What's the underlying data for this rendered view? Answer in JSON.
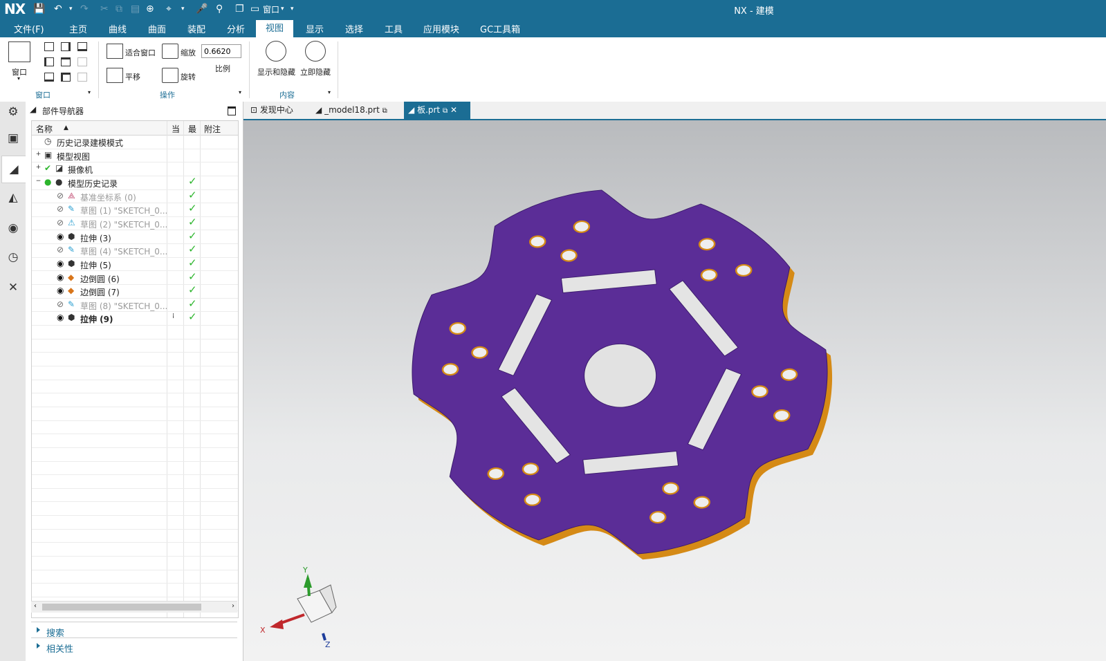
{
  "app": {
    "logo": "NX",
    "window_title": "NX - 建模",
    "window_menu": "窗口"
  },
  "menu": [
    "文件(F)",
    "主页",
    "曲线",
    "曲面",
    "装配",
    "分析",
    "视图",
    "显示",
    "选择",
    "工具",
    "应用模块",
    "GC工具箱"
  ],
  "active_menu": "视图",
  "ribbon": {
    "window_btn": "窗口",
    "fit": "适合窗口",
    "zoom": "缩放",
    "pan": "平移",
    "rotate": "旋转",
    "scale_value": "0.6620",
    "scale_label": "比例",
    "show_hide": "显示和隐藏",
    "instant_hide": "立即隐藏",
    "group_window": "窗口",
    "group_ops": "操作",
    "group_content": "内容"
  },
  "navigator": {
    "title": "部件导航器",
    "col_name": "名称",
    "col_current": "当",
    "col_latest": "最",
    "col_notes": "附注",
    "rows": [
      {
        "label": "历史记录建模模式",
        "indent": 0,
        "check": false,
        "dim": false,
        "bold": false,
        "icon": "clock-icon"
      },
      {
        "label": "模型视图",
        "indent": 0,
        "check": false,
        "dim": false,
        "bold": false,
        "icon": "model-view-icon"
      },
      {
        "label": "摄像机",
        "indent": 1,
        "check": false,
        "dim": false,
        "bold": false,
        "icon": "camera-icon"
      },
      {
        "label": "模型历史记录",
        "indent": 1,
        "check": true,
        "dim": false,
        "bold": false,
        "icon": "history-icon"
      },
      {
        "label": "基准坐标系 (0)",
        "indent": 2,
        "check": true,
        "dim": true,
        "bold": false,
        "icon": "datum-csys-icon"
      },
      {
        "label": "草图 (1) \"SKETCH_0...",
        "indent": 2,
        "check": true,
        "dim": true,
        "bold": false,
        "icon": "sketch-icon"
      },
      {
        "label": "草图 (2) \"SKETCH_0...",
        "indent": 2,
        "check": true,
        "dim": true,
        "bold": false,
        "icon": "sketch-warning-icon"
      },
      {
        "label": "拉伸 (3)",
        "indent": 2,
        "check": true,
        "dim": false,
        "bold": false,
        "icon": "extrude-icon"
      },
      {
        "label": "草图 (4) \"SKETCH_0...",
        "indent": 2,
        "check": true,
        "dim": true,
        "bold": false,
        "icon": "sketch-icon"
      },
      {
        "label": "拉伸 (5)",
        "indent": 2,
        "check": true,
        "dim": false,
        "bold": false,
        "icon": "extrude-icon"
      },
      {
        "label": "边倒圆 (6)",
        "indent": 2,
        "check": true,
        "dim": false,
        "bold": false,
        "icon": "edge-blend-icon"
      },
      {
        "label": "边倒圆 (7)",
        "indent": 2,
        "check": true,
        "dim": false,
        "bold": false,
        "icon": "edge-blend-icon"
      },
      {
        "label": "草图 (8) \"SKETCH_0...",
        "indent": 2,
        "check": true,
        "dim": true,
        "bold": false,
        "icon": "sketch-icon"
      },
      {
        "label": "拉伸 (9)",
        "indent": 2,
        "check": true,
        "dim": false,
        "bold": true,
        "icon": "extrude-icon"
      }
    ],
    "search": "搜索",
    "related": "相关性"
  },
  "tabs": [
    {
      "label": "发现中心",
      "active": false
    },
    {
      "label": "_model18.prt",
      "active": false
    },
    {
      "label": "板.prt",
      "active": true
    }
  ],
  "triad": {
    "x": "X",
    "y": "Y",
    "z": "Z"
  },
  "colors": {
    "brand": "#1b6d94",
    "part": "#5b2d97",
    "part_edge": "#d58a16",
    "check": "#2db52d"
  }
}
